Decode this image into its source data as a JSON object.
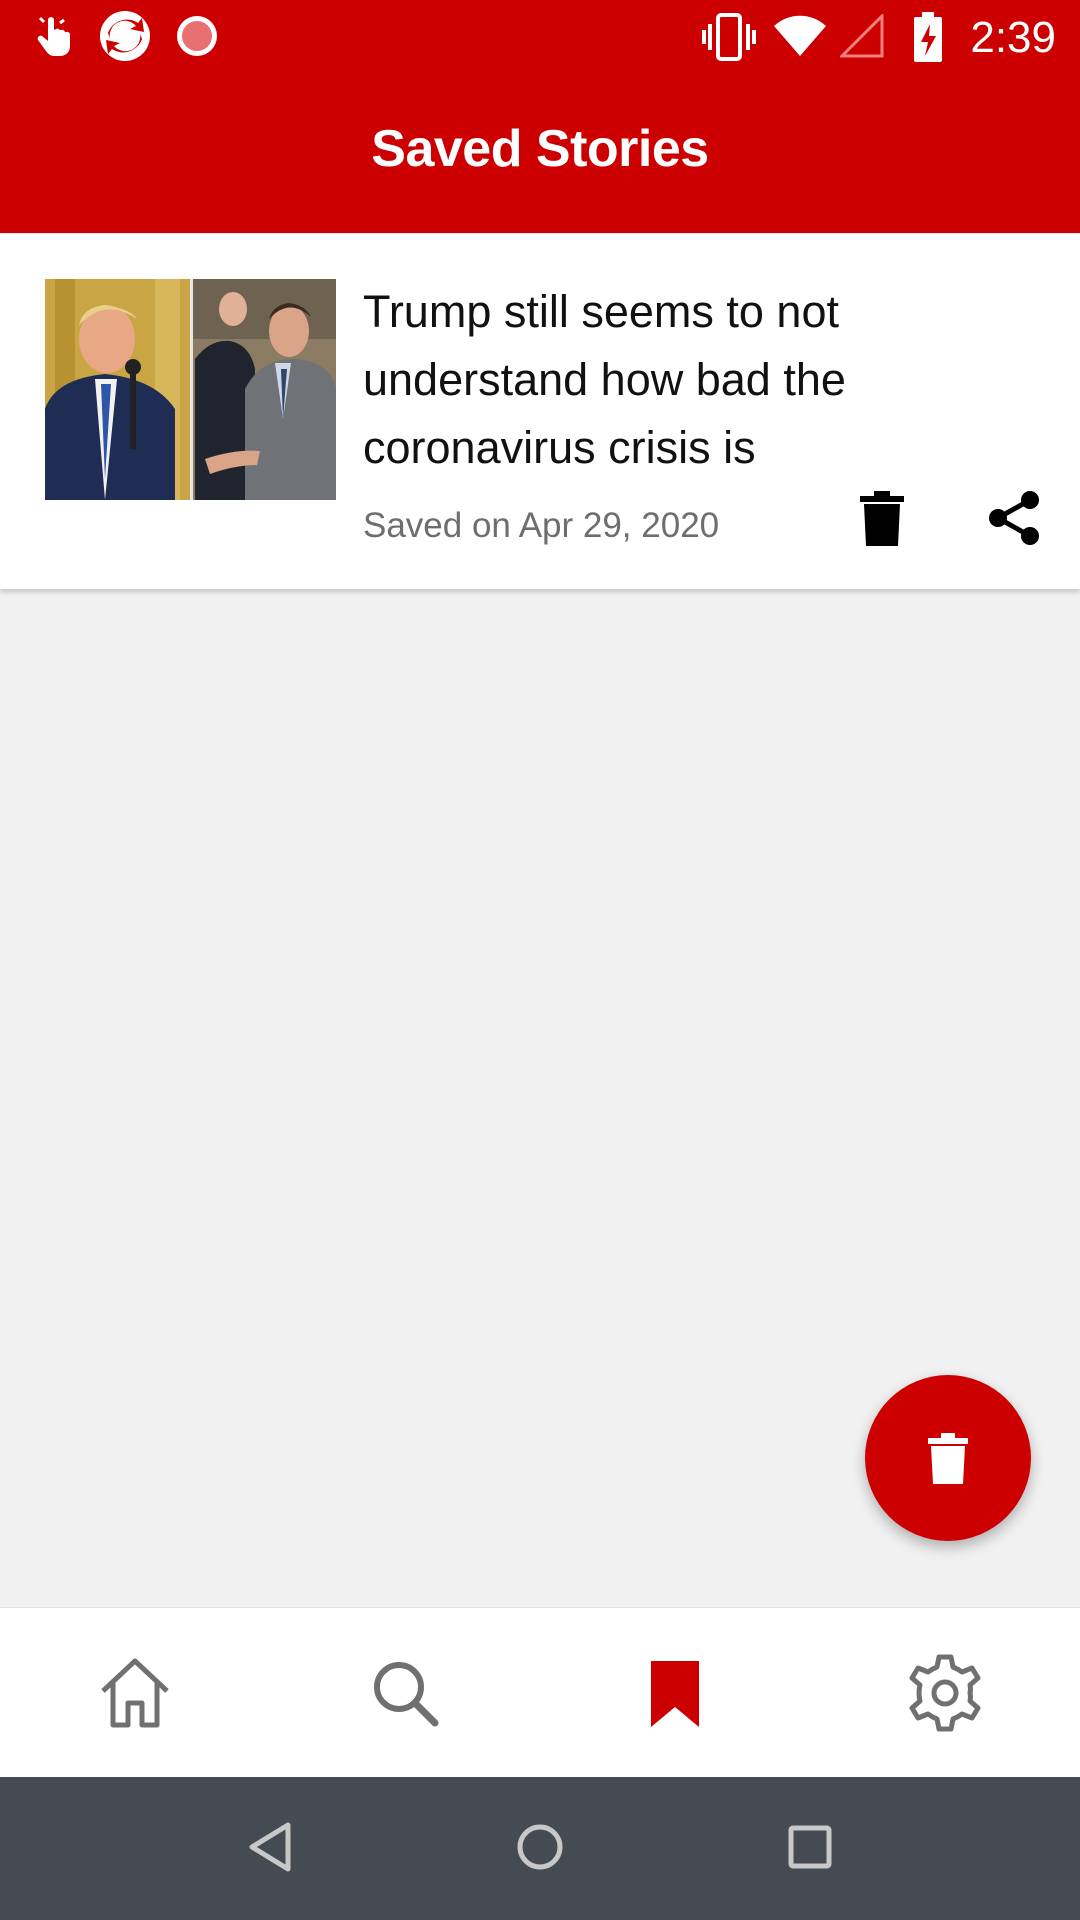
{
  "status_bar": {
    "time": "2:39",
    "left_icons": [
      "hand-tap-icon",
      "app-sync-icon",
      "record-icon"
    ],
    "right_icons": [
      "vibrate-icon",
      "wifi-icon",
      "signal-icon",
      "battery-charging-icon"
    ]
  },
  "app_bar": {
    "title": "Saved Stories"
  },
  "stories": [
    {
      "title": "Trump still seems to not understand how bad the coronavirus crisis is",
      "saved_label": "Saved on Apr 29, 2020",
      "thumbnail": "news-thumbnail",
      "actions": [
        "trash-icon",
        "share-icon"
      ]
    }
  ],
  "fab": {
    "icon": "trash-icon"
  },
  "bottom_nav": {
    "items": [
      {
        "icon": "home-icon",
        "active": false
      },
      {
        "icon": "search-icon",
        "active": false
      },
      {
        "icon": "bookmark-icon",
        "active": true
      },
      {
        "icon": "gear-icon",
        "active": false
      }
    ]
  },
  "system_nav": {
    "items": [
      "back-icon",
      "home-circle-icon",
      "recents-icon"
    ]
  },
  "colors": {
    "brand_red": "#cc0000",
    "background": "#f1f1f1",
    "system_nav": "#454b52",
    "inactive_icon": "#707070"
  }
}
